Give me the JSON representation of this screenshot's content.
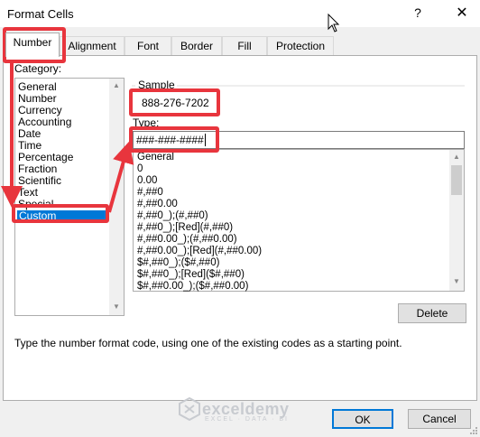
{
  "window": {
    "title": "Format Cells",
    "help_label": "?",
    "close_label": "✕"
  },
  "tabs": [
    "Number",
    "Alignment",
    "Font",
    "Border",
    "Fill",
    "Protection"
  ],
  "category": {
    "label": "Category:",
    "items": [
      "General",
      "Number",
      "Currency",
      "Accounting",
      "Date",
      "Time",
      "Percentage",
      "Fraction",
      "Scientific",
      "Text",
      "Special",
      "Custom"
    ],
    "selected": "Custom"
  },
  "sample": {
    "label": "Sample",
    "value": "888-276-7202"
  },
  "type": {
    "label": "Type:",
    "value": "###-###-####",
    "formats": [
      "General",
      "0",
      "0.00",
      "#,##0",
      "#,##0.00",
      "#,##0_);(#,##0)",
      "#,##0_);[Red](#,##0)",
      "#,##0.00_);(#,##0.00)",
      "#,##0.00_);[Red](#,##0.00)",
      "$#,##0_);($#,##0)",
      "$#,##0_);[Red]($#,##0)",
      "$#,##0.00_);($#,##0.00)"
    ]
  },
  "buttons": {
    "delete": "Delete",
    "ok": "OK",
    "cancel": "Cancel"
  },
  "hint": "Type the number format code, using one of the existing codes as a starting point.",
  "watermark": {
    "name": "exceldemy",
    "tagline": "EXCEL · DATA · BI"
  },
  "colors": {
    "annotation_red": "#e8353d",
    "selection_blue": "#0078d7",
    "dialog_bg": "#f0f0f0"
  }
}
